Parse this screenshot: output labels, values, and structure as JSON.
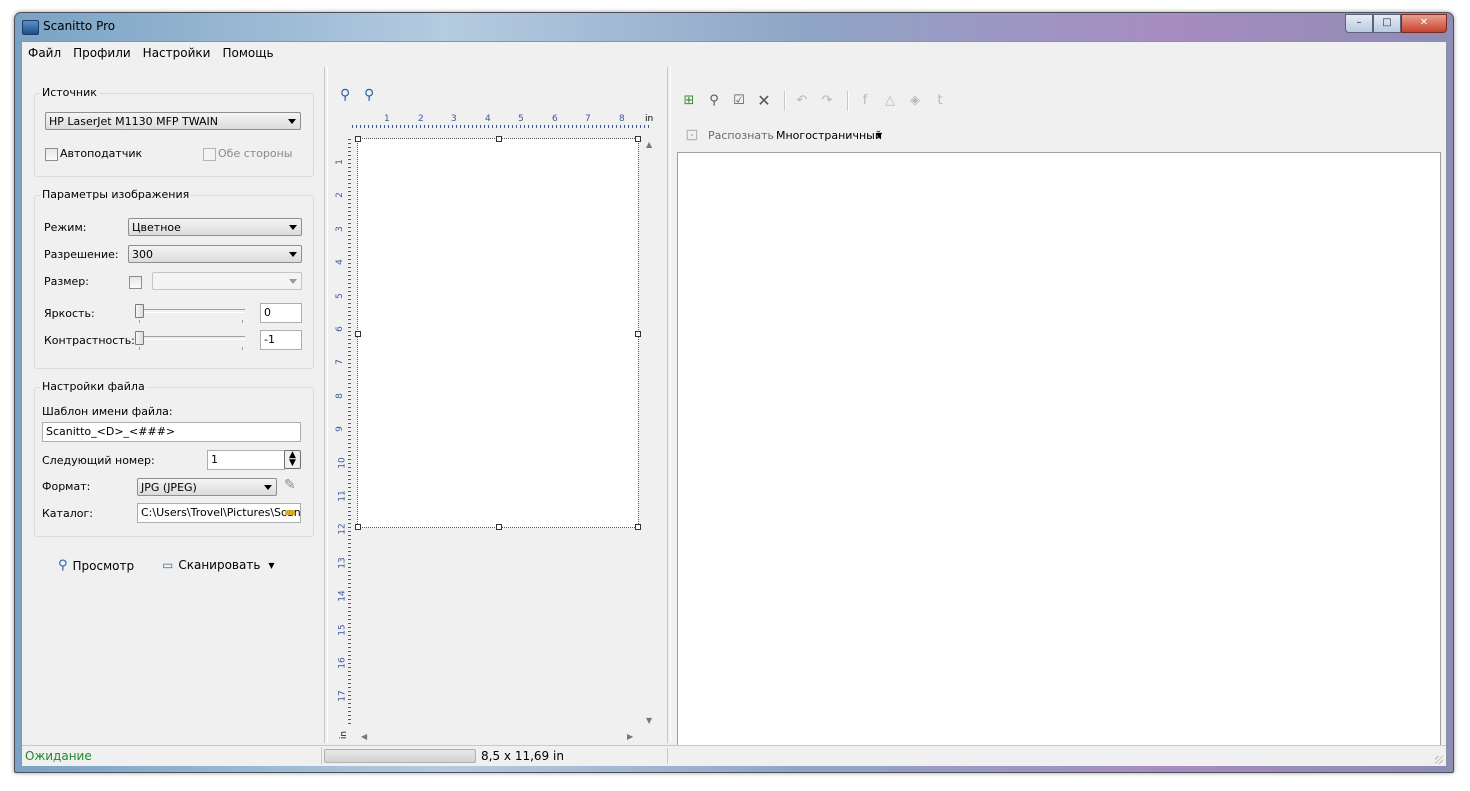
{
  "window": {
    "title": "Scanitto Pro",
    "buttons": {
      "minimize": "–",
      "maximize": "□",
      "close": "✕"
    }
  },
  "menu": [
    "Файл",
    "Профили",
    "Настройки",
    "Помощь"
  ],
  "source": {
    "group_title": "Источник",
    "device": "HP LaserJet M1130 MFP TWAIN",
    "autofeeder_label": "Автоподатчик",
    "autofeeder_checked": false,
    "duplex_label": "Обе стороны",
    "duplex_checked": false
  },
  "image_params": {
    "group_title": "Параметры изображения",
    "mode_label": "Режим:",
    "mode_value": "Цветное",
    "resolution_label": "Разрешение:",
    "resolution_value": "300",
    "size_label": "Размер:",
    "size_value": "",
    "brightness_label": "Яркость:",
    "brightness_value": "0",
    "contrast_label": "Контрастность:",
    "contrast_value": "-1"
  },
  "file_settings": {
    "group_title": "Настройки файла",
    "template_label": "Шаблон имени файла:",
    "template_value": "Scanitto_<D>_<###>",
    "next_number_label": "Следующий номер:",
    "next_number_value": "1",
    "format_label": "Формат:",
    "format_value": "JPG (JPEG)",
    "folder_label": "Каталог:",
    "folder_value": "C:\\Users\\Trovel\\Pictures\\Scan"
  },
  "actions": {
    "preview_label": "Просмотр",
    "scan_label": "Сканировать"
  },
  "ruler": {
    "unit": "in",
    "h_ticks": [
      "1",
      "2",
      "3",
      "4",
      "5",
      "6",
      "7",
      "8"
    ],
    "v_ticks": [
      "1",
      "2",
      "3",
      "4",
      "5",
      "6",
      "7",
      "8",
      "9",
      "10",
      "11",
      "12",
      "13",
      "14",
      "15",
      "16",
      "17"
    ]
  },
  "right_toolbar": {
    "recognize_label": "Распознать",
    "multipage_label": "Многостраничный"
  },
  "status": {
    "text": "Ожидание",
    "page_size": "8,5 x 11,69 in"
  },
  "colors": {
    "status_green": "#1d8a2a",
    "ruler_blue": "#3c5a9a"
  }
}
